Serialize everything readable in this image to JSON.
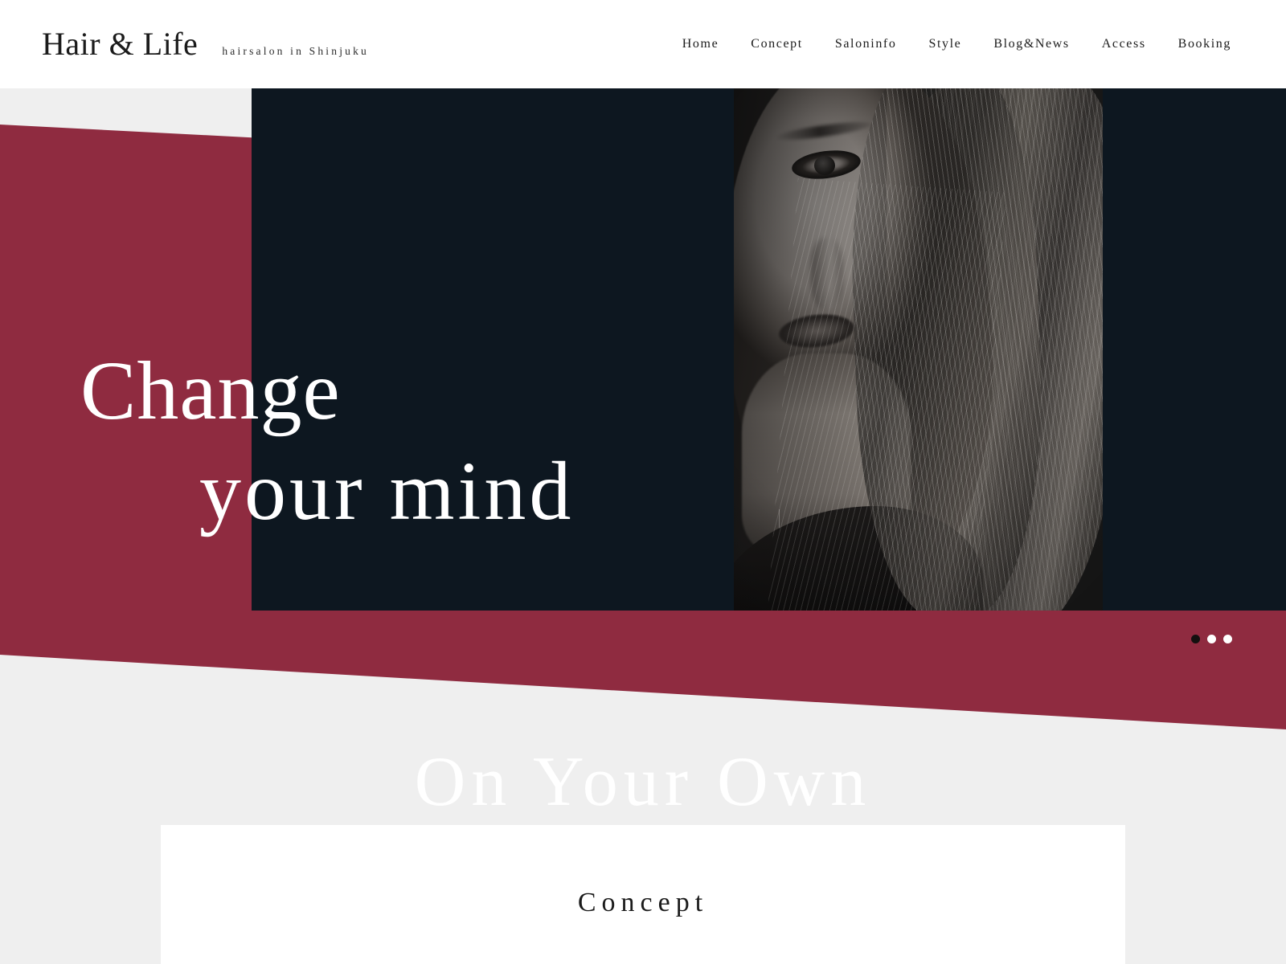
{
  "site": {
    "brand": "Hair & Life",
    "tagline": "hairsalon in Shinjuku"
  },
  "nav": {
    "items": [
      {
        "label": "Home"
      },
      {
        "label": "Concept"
      },
      {
        "label": "Saloninfo"
      },
      {
        "label": "Style"
      },
      {
        "label": "Blog&News"
      },
      {
        "label": "Access"
      },
      {
        "label": "Booking"
      }
    ]
  },
  "hero": {
    "headline_line1": "Change",
    "headline_line2": "your mind",
    "slider": {
      "dots": [
        {
          "active": true
        },
        {
          "active": false
        },
        {
          "active": false
        }
      ]
    },
    "photo_alt": "monochrome portrait of woman with long hair"
  },
  "concept": {
    "watermark": "On Your Own",
    "title": "Concept"
  },
  "colors": {
    "accent_red": "#8f2b40",
    "dark_navy": "#0d1720",
    "page_bg": "#efefef",
    "card_bg": "#ffffff",
    "text_dark": "#1b1b1b",
    "text_light": "#ffffff"
  }
}
